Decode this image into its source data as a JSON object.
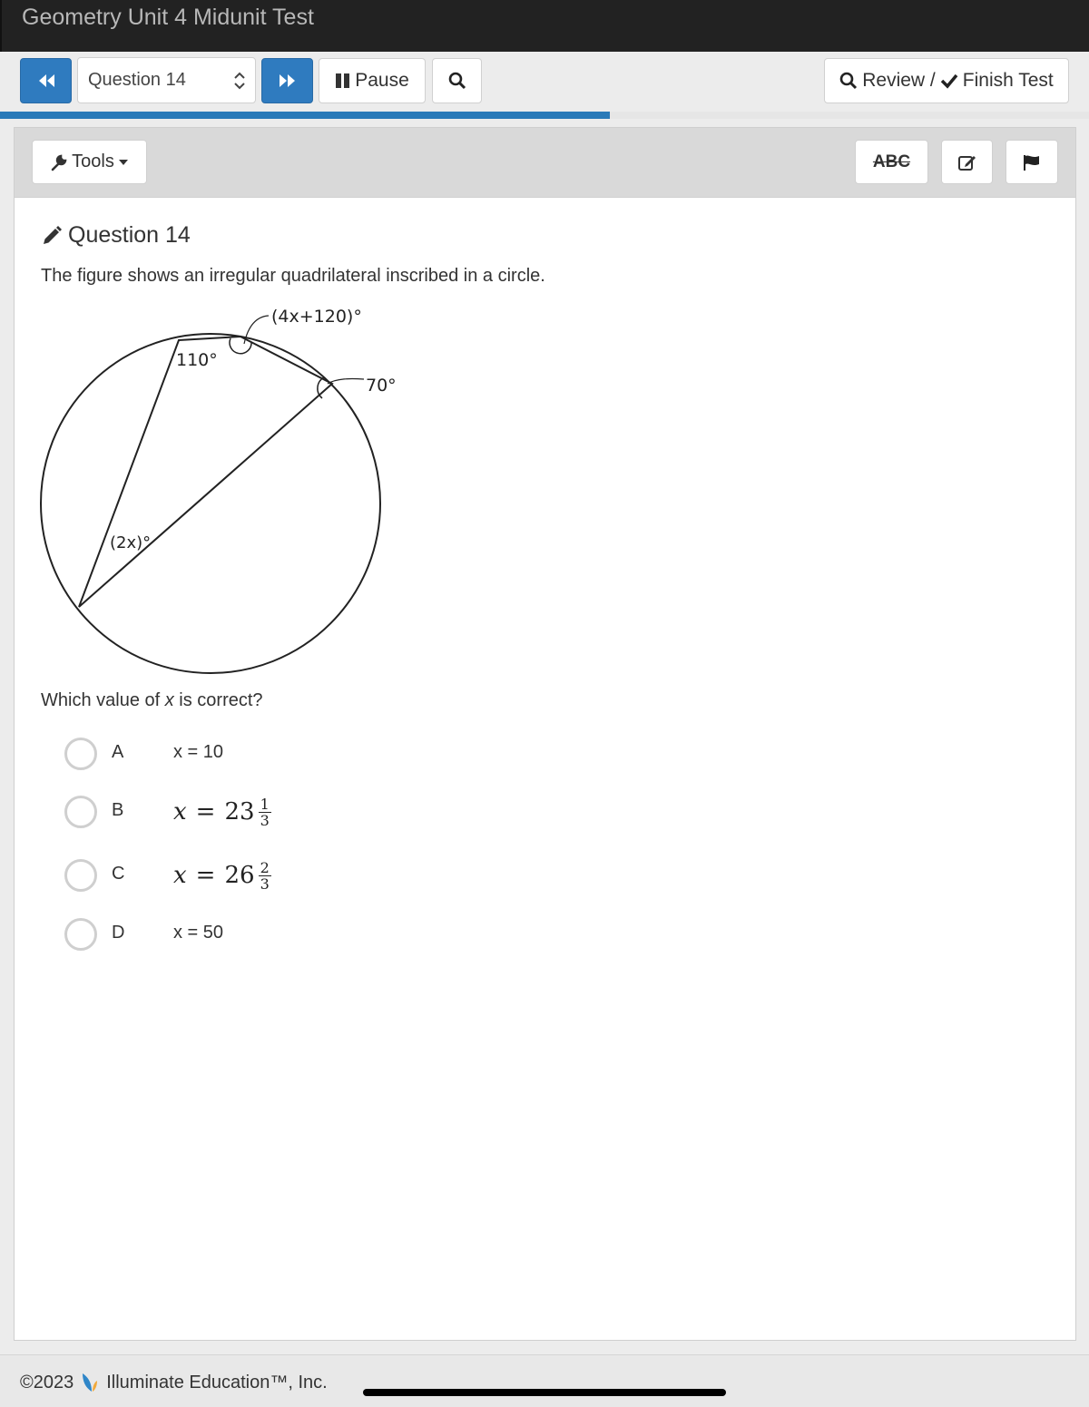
{
  "window": {
    "title": "Geometry Unit 4 Midunit Test"
  },
  "navbar": {
    "prev_icon": "double-chevron-left-icon",
    "question_select": {
      "value": "Question 14"
    },
    "next_icon": "double-chevron-right-icon",
    "pause_label": "Pause",
    "search_icon": "search-icon",
    "review_label": "Review /",
    "finish_label": "Finish Test"
  },
  "progress": {
    "percent": 56
  },
  "toolbar": {
    "tools_label": "Tools",
    "strike_label": "ABC",
    "note_icon": "edit-note-icon",
    "flag_icon": "flag-icon"
  },
  "question": {
    "heading": "Question 14",
    "text": "The figure shows an irregular quadrilateral inscribed in a circle.",
    "figure": {
      "labels": {
        "top_right_angle": "(4x+120)°",
        "top_left_angle": "110°",
        "right_angle": "70°",
        "left_angle": "(2x)°"
      }
    },
    "prompt_before": "Which value of ",
    "prompt_var": "x",
    "prompt_after": " is correct?",
    "choices": [
      {
        "letter": "A",
        "text": "x = 10"
      },
      {
        "letter": "B",
        "var": "x",
        "whole": "23",
        "num": "1",
        "den": "3"
      },
      {
        "letter": "C",
        "var": "x",
        "whole": "26",
        "num": "2",
        "den": "3"
      },
      {
        "letter": "D",
        "text": "x = 50"
      }
    ]
  },
  "footer": {
    "copyright": "©2023",
    "company": "Illuminate Education™, Inc."
  }
}
